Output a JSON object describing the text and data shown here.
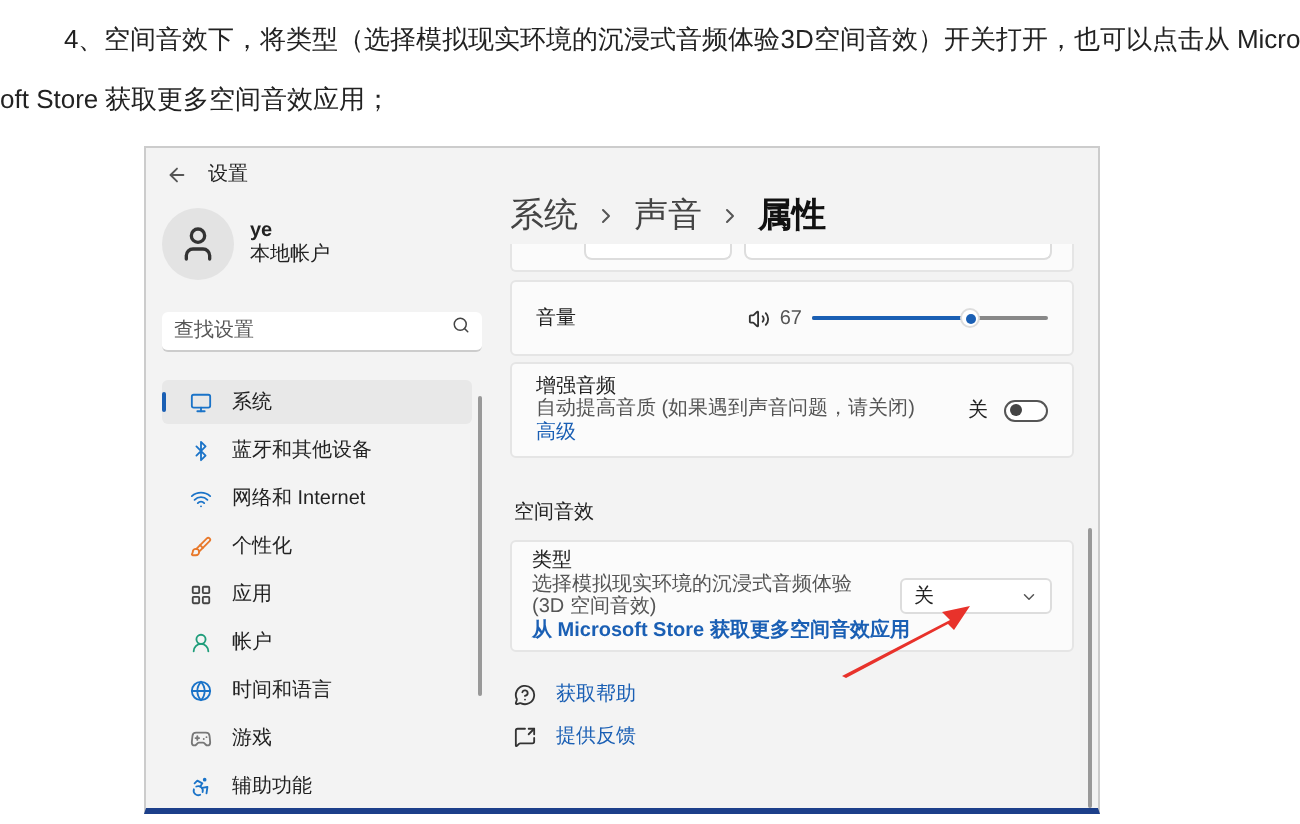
{
  "article": {
    "lines": [
      "4、空间音效下，将类型（选择模拟现实环境的沉浸式音频体验3D空间音效）开关打开，也可以点击从 Micro",
      "oft Store 获取更多空间音效应用；"
    ]
  },
  "settings_window": {
    "title": "设置",
    "user": {
      "name": "ye",
      "account": "本地帐户"
    },
    "search": {
      "placeholder": "查找设置"
    },
    "nav_items": [
      {
        "label": "系统",
        "selected": true
      },
      {
        "label": "蓝牙和其他设备",
        "selected": false
      },
      {
        "label": "网络和 Internet",
        "selected": false
      },
      {
        "label": "个性化",
        "selected": false
      },
      {
        "label": "应用",
        "selected": false
      },
      {
        "label": "帐户",
        "selected": false
      },
      {
        "label": "时间和语言",
        "selected": false
      },
      {
        "label": "游戏",
        "selected": false
      },
      {
        "label": "辅助功能",
        "selected": false
      }
    ],
    "breadcrumb": [
      "系统",
      "声音",
      "属性"
    ],
    "volume": {
      "label": "音量",
      "reading": "67",
      "level": 0.67
    },
    "enhance": {
      "title": "增强音频",
      "description": "自动提高音质 (如果遇到声音问题，请关闭)",
      "link": "高级",
      "state_label": "关",
      "on": false
    },
    "section_title": "空间音效",
    "spatial_type": {
      "title": "类型",
      "description": "选择模拟现实环境的沉浸式音频体验 (3D 空间音效)",
      "link": "从 Microsoft Store 获取更多空间音效应用",
      "value": "关"
    },
    "footer_links": [
      "获取帮助",
      "提供反馈"
    ]
  }
}
